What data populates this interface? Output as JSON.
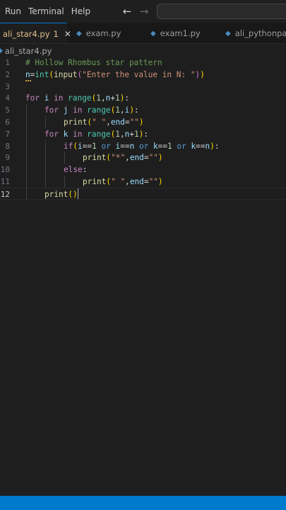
{
  "menubar": {
    "items": [
      "Run",
      "Terminal",
      "Help"
    ]
  },
  "nav": {
    "back": "←",
    "forward": "→"
  },
  "tabs": [
    {
      "label": "ali_star4.py",
      "badge": "1",
      "active": true
    },
    {
      "label": "exam.py",
      "active": false
    },
    {
      "label": "exam1.py",
      "active": false
    },
    {
      "label": "ali_pythonpatt",
      "active": false
    }
  ],
  "breadcrumb": {
    "file": "ali_star4.py"
  },
  "editor": {
    "lines": [
      {
        "n": "1",
        "tokens": [
          [
            "# Hollow Rhombus star pattern",
            "cm"
          ]
        ]
      },
      {
        "n": "2",
        "tokens": [
          [
            "n",
            "var"
          ],
          [
            "=",
            "op"
          ],
          [
            "int",
            "bi"
          ],
          [
            "(",
            "b1"
          ],
          [
            "input",
            "fn"
          ],
          [
            "(",
            "b2"
          ],
          [
            "\"Enter the value in N: \"",
            "str"
          ],
          [
            ")",
            "b2"
          ],
          [
            ")",
            "b1"
          ]
        ]
      },
      {
        "n": "3",
        "tokens": []
      },
      {
        "n": "4",
        "tokens": [
          [
            "for",
            "ctl"
          ],
          [
            " ",
            "op"
          ],
          [
            "i",
            "var"
          ],
          [
            " ",
            "op"
          ],
          [
            "in",
            "ctl"
          ],
          [
            " ",
            "op"
          ],
          [
            "range",
            "bi"
          ],
          [
            "(",
            "b1"
          ],
          [
            "1",
            "num"
          ],
          [
            ",",
            "op"
          ],
          [
            "n",
            "var"
          ],
          [
            "+",
            "op"
          ],
          [
            "1",
            "num"
          ],
          [
            ")",
            "b1"
          ],
          [
            ":",
            "op"
          ]
        ]
      },
      {
        "n": "5",
        "indent": 1,
        "tokens": [
          [
            "for",
            "ctl"
          ],
          [
            " ",
            "op"
          ],
          [
            "j",
            "var"
          ],
          [
            " ",
            "op"
          ],
          [
            "in",
            "ctl"
          ],
          [
            " ",
            "op"
          ],
          [
            "range",
            "bi"
          ],
          [
            "(",
            "b1"
          ],
          [
            "1",
            "num"
          ],
          [
            ",",
            "op"
          ],
          [
            "i",
            "var"
          ],
          [
            ")",
            "b1"
          ],
          [
            ":",
            "op"
          ]
        ]
      },
      {
        "n": "6",
        "indent": 2,
        "tokens": [
          [
            "print",
            "fn"
          ],
          [
            "(",
            "b1"
          ],
          [
            "\" \"",
            "str"
          ],
          [
            ",",
            "op"
          ],
          [
            "end",
            "var"
          ],
          [
            "=",
            "op"
          ],
          [
            "\"\"",
            "str"
          ],
          [
            ")",
            "b1"
          ]
        ]
      },
      {
        "n": "7",
        "indent": 1,
        "tokens": [
          [
            "for",
            "ctl"
          ],
          [
            " ",
            "op"
          ],
          [
            "k",
            "var"
          ],
          [
            " ",
            "op"
          ],
          [
            "in",
            "ctl"
          ],
          [
            " ",
            "op"
          ],
          [
            "range",
            "bi"
          ],
          [
            "(",
            "b1"
          ],
          [
            "1",
            "num"
          ],
          [
            ",",
            "op"
          ],
          [
            "n",
            "var"
          ],
          [
            "+",
            "op"
          ],
          [
            "1",
            "num"
          ],
          [
            ")",
            "b1"
          ],
          [
            ":",
            "op"
          ]
        ]
      },
      {
        "n": "8",
        "indent": 2,
        "tokens": [
          [
            "if",
            "ctl"
          ],
          [
            "(",
            "b1"
          ],
          [
            "i",
            "var"
          ],
          [
            "==",
            "op"
          ],
          [
            "1",
            "num"
          ],
          [
            " ",
            "op"
          ],
          [
            "or",
            "blue"
          ],
          [
            " ",
            "op"
          ],
          [
            "i",
            "var"
          ],
          [
            "==",
            "op"
          ],
          [
            "n",
            "var"
          ],
          [
            " ",
            "op"
          ],
          [
            "or",
            "blue"
          ],
          [
            " ",
            "op"
          ],
          [
            "k",
            "var"
          ],
          [
            "==",
            "op"
          ],
          [
            "1",
            "num"
          ],
          [
            " ",
            "op"
          ],
          [
            "or",
            "blue"
          ],
          [
            " ",
            "op"
          ],
          [
            "k",
            "var"
          ],
          [
            "==",
            "op"
          ],
          [
            "n",
            "var"
          ],
          [
            ")",
            "b1"
          ],
          [
            ":",
            "op"
          ]
        ]
      },
      {
        "n": "9",
        "indent": 3,
        "tokens": [
          [
            "print",
            "fn"
          ],
          [
            "(",
            "b1"
          ],
          [
            "\"*\"",
            "str"
          ],
          [
            ",",
            "op"
          ],
          [
            "end",
            "var"
          ],
          [
            "=",
            "op"
          ],
          [
            "\"\"",
            "str"
          ],
          [
            ")",
            "b1"
          ]
        ]
      },
      {
        "n": "10",
        "indent": 2,
        "tokens": [
          [
            "else",
            "ctl"
          ],
          [
            ":",
            "op"
          ]
        ]
      },
      {
        "n": "11",
        "indent": 3,
        "tokens": [
          [
            "print",
            "fn"
          ],
          [
            "(",
            "b1"
          ],
          [
            "\" \"",
            "str"
          ],
          [
            ",",
            "op"
          ],
          [
            "end",
            "var"
          ],
          [
            "=",
            "op"
          ],
          [
            "\"\"",
            "str"
          ],
          [
            ")",
            "b1"
          ]
        ]
      },
      {
        "n": "12",
        "indent": 1,
        "current": true,
        "tokens": [
          [
            "print",
            "fn"
          ],
          [
            "(",
            "b1"
          ],
          [
            ")",
            "b1"
          ]
        ]
      }
    ]
  },
  "colors": {
    "accent": "#0078d4",
    "statusbar": "#007acc",
    "modified_tab": "#e2c08d"
  },
  "icons": {
    "python_file": "python-file-icon",
    "close": "close-icon",
    "back": "arrow-left-icon",
    "forward": "arrow-right-icon"
  }
}
